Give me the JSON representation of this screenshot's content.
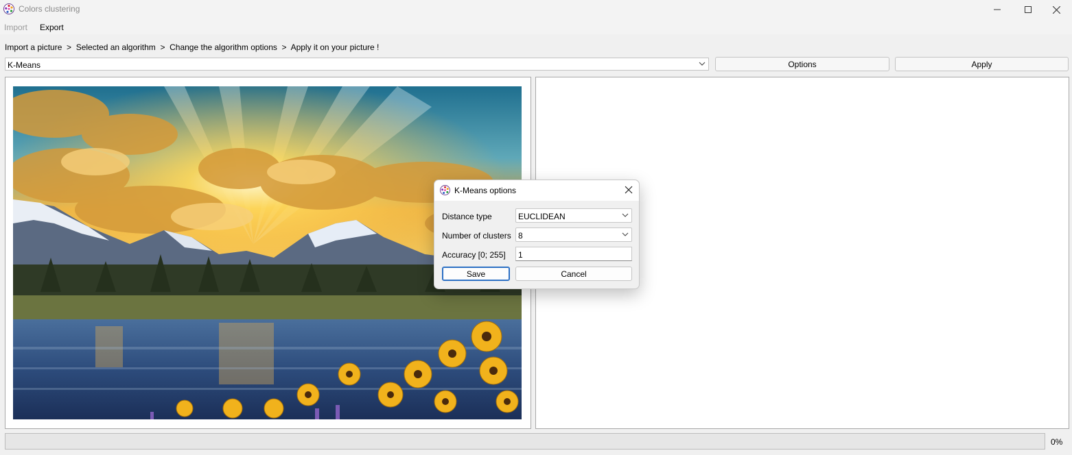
{
  "window": {
    "title": "Colors clustering",
    "minimize_icon": "minimize-icon",
    "maximize_icon": "maximize-icon",
    "close_icon": "close-icon"
  },
  "menu": {
    "import_label": "Import",
    "import_enabled": false,
    "export_label": "Export"
  },
  "breadcrumb": "Import a picture  >  Selected an algorithm  >  Change the algorithm options  >  Apply it on your picture !",
  "toolbar": {
    "algorithm_selected": "K-Means",
    "options_label": "Options",
    "apply_label": "Apply"
  },
  "status": {
    "progress_value": 0,
    "progress_text": "0%"
  },
  "dialog": {
    "title": "K-Means options",
    "fields": {
      "distance_type_label": "Distance type",
      "distance_type_value": "EUCLIDEAN",
      "clusters_label": "Number of clusters",
      "clusters_value": "8",
      "accuracy_label": "Accuracy [0; 255]",
      "accuracy_value": "1"
    },
    "save_label": "Save",
    "cancel_label": "Cancel"
  },
  "colors": {
    "accent": "#2b6fc4",
    "progress": "#06b025"
  }
}
